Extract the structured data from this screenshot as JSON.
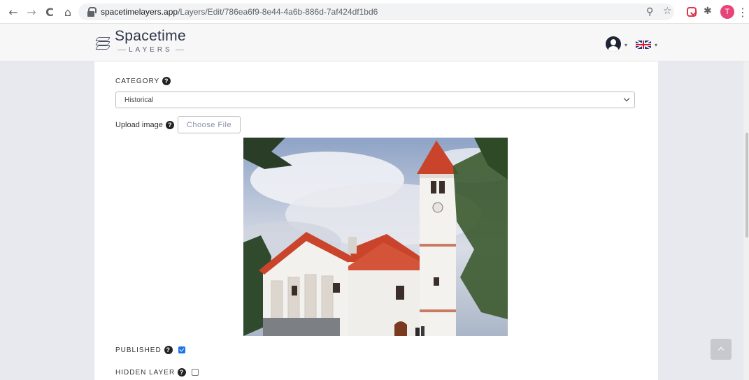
{
  "browser": {
    "back_glyph": "←",
    "forward_glyph": "→",
    "reload_glyph": "C",
    "home_glyph": "⌂",
    "url_host": "spacetimelayers.app",
    "url_path": "/Layers/Edit/786ea6f9-8e44-4a6b-886d-7af424df1bd6",
    "zoom_glyph": "⚲",
    "star_glyph": "☆",
    "profile_initial": "T",
    "menu_glyph": "⋮"
  },
  "header": {
    "logo_title": "Spacetime",
    "logo_subtitle": "LAYERS"
  },
  "form": {
    "category_label": "CATEGORY",
    "category_value": "Historical",
    "upload_label": "Upload image",
    "choose_file_label": "Choose File",
    "published_label": "PUBLISHED",
    "published_checked": true,
    "hidden_label": "HIDDEN LAYER",
    "hidden_checked": false,
    "help_glyph": "?"
  },
  "colors": {
    "accent": "#1a73e8",
    "roof": "#c9442a",
    "page_bg": "#e8e8ef"
  }
}
